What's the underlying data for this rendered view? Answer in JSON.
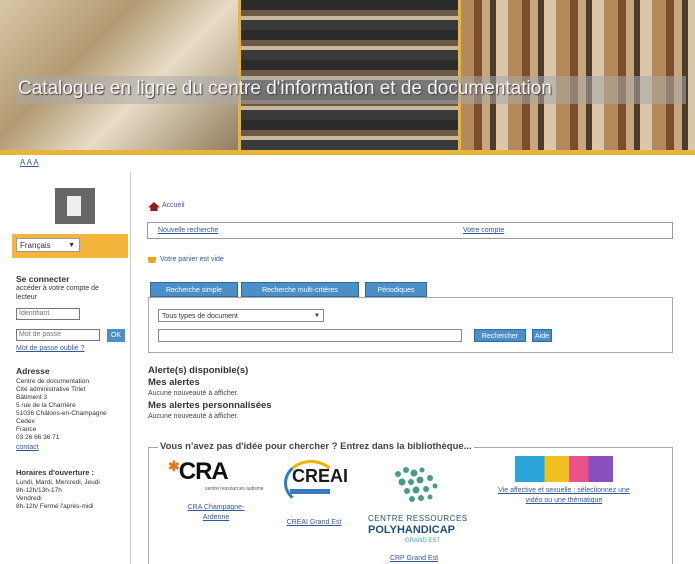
{
  "banner": {
    "title": "Catalogue en ligne du centre d'information et de documentation"
  },
  "font_size": {
    "label": "A A A"
  },
  "sidebar": {
    "language": "Français",
    "connect_heading": "Se connecter",
    "connect_desc_1": "accéder à votre compte de",
    "connect_desc_2": "lecteur",
    "login_placeholder": "Identifiant",
    "password_placeholder": "Mot de passe",
    "ok_label": "OK",
    "forgot_link": "Mot de passe oublié ?",
    "address_heading": "Adresse",
    "address_lines": [
      "Centre de documentation",
      "Cité administrative Tirlet",
      "Bâtiment 3",
      "5 rue de la Charrière",
      "51036 Châlons-en-Champagne",
      "Cedex",
      "France",
      "03 26 66 36 71"
    ],
    "contact_link": "contact",
    "hours_heading": "Horaires d'ouverture :",
    "hours_lines": [
      "Lundi, Mardi, Mercredi, Jeudi",
      "8h-12h/13h-17h",
      "Vendredi",
      "8h-12h/ Fermé l'après-midi"
    ]
  },
  "main": {
    "breadcrumb_home": "Accueil",
    "nav_links": [
      "Nouvelle recherche",
      "Votre compte"
    ],
    "cart": "Votre panier est vide",
    "tabs": [
      "Recherche simple",
      "Recherche multi-critères",
      "Périodiques"
    ],
    "doc_type": "Tous types de document",
    "buttons": [
      "Rechercher",
      "Aide"
    ],
    "alerts_heading": "Alerte(s) disponible(s)",
    "my_alerts": "Mes alertes",
    "my_alerts_note": "Aucune nouveauté à afficher.",
    "custom_alerts": "Mes alertes personnalisées",
    "custom_alerts_note": "Aucune nouveauté à afficher.",
    "ideas_title": "Vous n'avez pas d'idée pour chercher ? Entrez dans la bibliothèque...",
    "partners": {
      "cra_mark": "CRA",
      "cra_sub": "centre ressources autisme",
      "cra_label_1": "CRA Champagne-",
      "cra_label_2": "Ardenne",
      "creai_mark": "CREAI",
      "creai_label": "CREAI Grand Est",
      "crp_line1": "CENTRE RESSOURCES",
      "crp_line2": "POLYHANDICAP",
      "crp_line3": "GRAND EST",
      "crp_label": "CRP Grand Est",
      "video_label_1": "Vie affective et sexuelle : sélectionnez une",
      "video_label_2": "vidéo ou une thématique"
    }
  },
  "colors": {
    "accent": "#e9b43a",
    "tab_blue": "#4c8fc7",
    "link": "#35579a"
  }
}
